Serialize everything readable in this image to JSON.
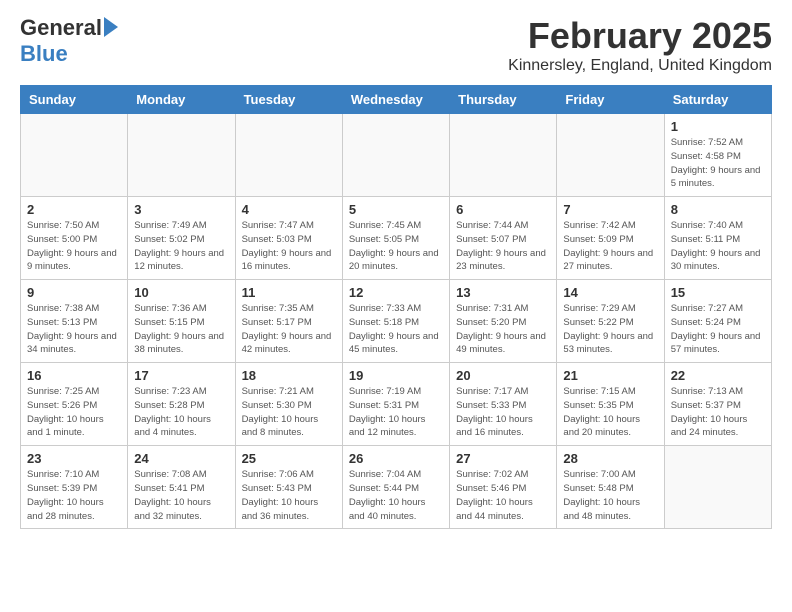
{
  "header": {
    "logo_general": "General",
    "logo_blue": "Blue",
    "title": "February 2025",
    "subtitle": "Kinnersley, England, United Kingdom"
  },
  "weekdays": [
    "Sunday",
    "Monday",
    "Tuesday",
    "Wednesday",
    "Thursday",
    "Friday",
    "Saturday"
  ],
  "weeks": [
    {
      "days": [
        {
          "num": "",
          "info": ""
        },
        {
          "num": "",
          "info": ""
        },
        {
          "num": "",
          "info": ""
        },
        {
          "num": "",
          "info": ""
        },
        {
          "num": "",
          "info": ""
        },
        {
          "num": "",
          "info": ""
        },
        {
          "num": "1",
          "info": "Sunrise: 7:52 AM\nSunset: 4:58 PM\nDaylight: 9 hours and 5 minutes."
        }
      ]
    },
    {
      "days": [
        {
          "num": "2",
          "info": "Sunrise: 7:50 AM\nSunset: 5:00 PM\nDaylight: 9 hours and 9 minutes."
        },
        {
          "num": "3",
          "info": "Sunrise: 7:49 AM\nSunset: 5:02 PM\nDaylight: 9 hours and 12 minutes."
        },
        {
          "num": "4",
          "info": "Sunrise: 7:47 AM\nSunset: 5:03 PM\nDaylight: 9 hours and 16 minutes."
        },
        {
          "num": "5",
          "info": "Sunrise: 7:45 AM\nSunset: 5:05 PM\nDaylight: 9 hours and 20 minutes."
        },
        {
          "num": "6",
          "info": "Sunrise: 7:44 AM\nSunset: 5:07 PM\nDaylight: 9 hours and 23 minutes."
        },
        {
          "num": "7",
          "info": "Sunrise: 7:42 AM\nSunset: 5:09 PM\nDaylight: 9 hours and 27 minutes."
        },
        {
          "num": "8",
          "info": "Sunrise: 7:40 AM\nSunset: 5:11 PM\nDaylight: 9 hours and 30 minutes."
        }
      ]
    },
    {
      "days": [
        {
          "num": "9",
          "info": "Sunrise: 7:38 AM\nSunset: 5:13 PM\nDaylight: 9 hours and 34 minutes."
        },
        {
          "num": "10",
          "info": "Sunrise: 7:36 AM\nSunset: 5:15 PM\nDaylight: 9 hours and 38 minutes."
        },
        {
          "num": "11",
          "info": "Sunrise: 7:35 AM\nSunset: 5:17 PM\nDaylight: 9 hours and 42 minutes."
        },
        {
          "num": "12",
          "info": "Sunrise: 7:33 AM\nSunset: 5:18 PM\nDaylight: 9 hours and 45 minutes."
        },
        {
          "num": "13",
          "info": "Sunrise: 7:31 AM\nSunset: 5:20 PM\nDaylight: 9 hours and 49 minutes."
        },
        {
          "num": "14",
          "info": "Sunrise: 7:29 AM\nSunset: 5:22 PM\nDaylight: 9 hours and 53 minutes."
        },
        {
          "num": "15",
          "info": "Sunrise: 7:27 AM\nSunset: 5:24 PM\nDaylight: 9 hours and 57 minutes."
        }
      ]
    },
    {
      "days": [
        {
          "num": "16",
          "info": "Sunrise: 7:25 AM\nSunset: 5:26 PM\nDaylight: 10 hours and 1 minute."
        },
        {
          "num": "17",
          "info": "Sunrise: 7:23 AM\nSunset: 5:28 PM\nDaylight: 10 hours and 4 minutes."
        },
        {
          "num": "18",
          "info": "Sunrise: 7:21 AM\nSunset: 5:30 PM\nDaylight: 10 hours and 8 minutes."
        },
        {
          "num": "19",
          "info": "Sunrise: 7:19 AM\nSunset: 5:31 PM\nDaylight: 10 hours and 12 minutes."
        },
        {
          "num": "20",
          "info": "Sunrise: 7:17 AM\nSunset: 5:33 PM\nDaylight: 10 hours and 16 minutes."
        },
        {
          "num": "21",
          "info": "Sunrise: 7:15 AM\nSunset: 5:35 PM\nDaylight: 10 hours and 20 minutes."
        },
        {
          "num": "22",
          "info": "Sunrise: 7:13 AM\nSunset: 5:37 PM\nDaylight: 10 hours and 24 minutes."
        }
      ]
    },
    {
      "days": [
        {
          "num": "23",
          "info": "Sunrise: 7:10 AM\nSunset: 5:39 PM\nDaylight: 10 hours and 28 minutes."
        },
        {
          "num": "24",
          "info": "Sunrise: 7:08 AM\nSunset: 5:41 PM\nDaylight: 10 hours and 32 minutes."
        },
        {
          "num": "25",
          "info": "Sunrise: 7:06 AM\nSunset: 5:43 PM\nDaylight: 10 hours and 36 minutes."
        },
        {
          "num": "26",
          "info": "Sunrise: 7:04 AM\nSunset: 5:44 PM\nDaylight: 10 hours and 40 minutes."
        },
        {
          "num": "27",
          "info": "Sunrise: 7:02 AM\nSunset: 5:46 PM\nDaylight: 10 hours and 44 minutes."
        },
        {
          "num": "28",
          "info": "Sunrise: 7:00 AM\nSunset: 5:48 PM\nDaylight: 10 hours and 48 minutes."
        },
        {
          "num": "",
          "info": ""
        }
      ]
    }
  ]
}
